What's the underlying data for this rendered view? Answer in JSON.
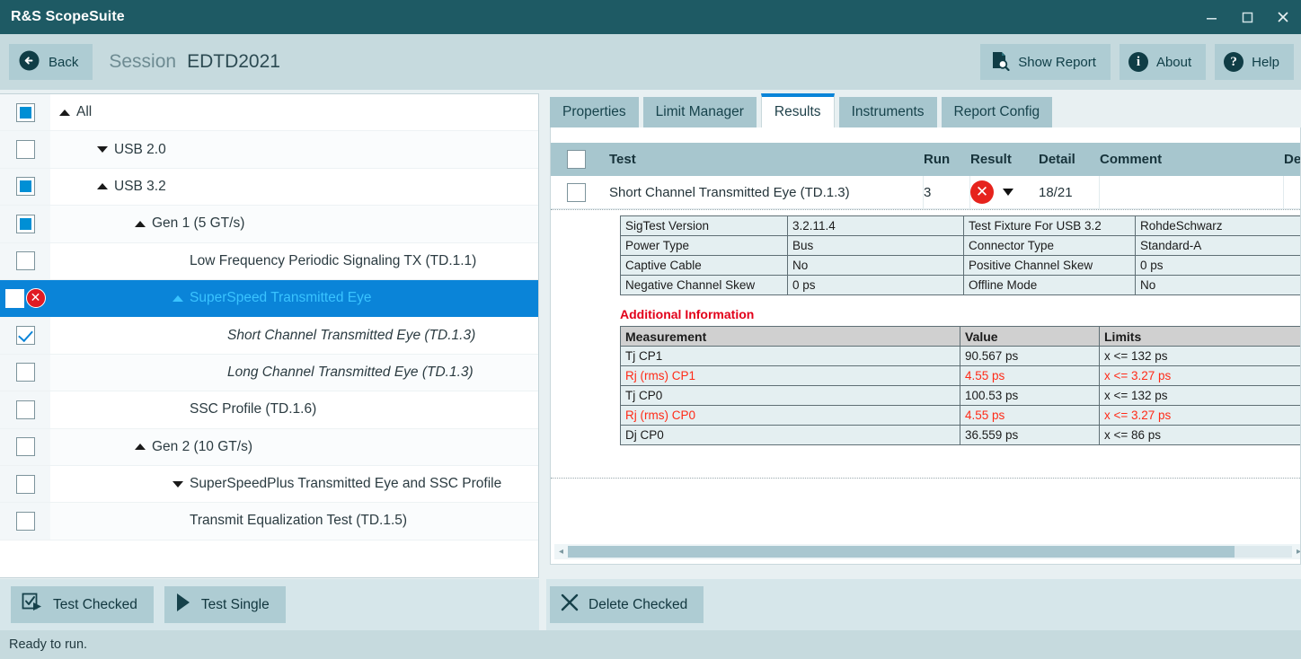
{
  "window": {
    "app_title": "R&S ScopeSuite",
    "minimize_icon": "minimize-icon",
    "maximize_icon": "maximize-icon",
    "close_icon": "close-icon"
  },
  "toolbar": {
    "back_label": "Back",
    "back_icon": "back-arrow-icon",
    "session_label": "Session",
    "session_value": "EDTD2021",
    "show_report_label": "Show Report",
    "show_report_icon": "report-search-icon",
    "about_label": "About",
    "about_icon": "info-icon",
    "about_glyph": "i",
    "help_label": "Help",
    "help_icon": "question-icon",
    "help_glyph": "?"
  },
  "tree": {
    "items": [
      {
        "label": "All",
        "indent": 0,
        "state": "filled",
        "expander": "up",
        "selected": false,
        "italic": false,
        "error": false
      },
      {
        "label": "USB 2.0",
        "indent": 1,
        "state": "empty",
        "expander": "down",
        "selected": false,
        "italic": false,
        "error": false
      },
      {
        "label": "USB 3.2",
        "indent": 1,
        "state": "filled",
        "expander": "up",
        "selected": false,
        "italic": false,
        "error": false
      },
      {
        "label": "Gen 1 (5 GT/s)",
        "indent": 2,
        "state": "filled",
        "expander": "up",
        "selected": false,
        "italic": false,
        "error": false
      },
      {
        "label": "Low Frequency Periodic Signaling TX (TD.1.1)",
        "indent": 3,
        "state": "empty",
        "expander": "none",
        "selected": false,
        "italic": false,
        "error": false
      },
      {
        "label": "SuperSpeed Transmitted Eye",
        "indent": 3,
        "state": "empty",
        "expander": "up",
        "selected": true,
        "italic": false,
        "error": true
      },
      {
        "label": "Short Channel Transmitted Eye (TD.1.3)",
        "indent": 4,
        "state": "checked",
        "expander": "none",
        "selected": false,
        "italic": true,
        "error": false
      },
      {
        "label": "Long Channel Transmitted Eye (TD.1.3)",
        "indent": 4,
        "state": "empty",
        "expander": "none",
        "selected": false,
        "italic": true,
        "error": false
      },
      {
        "label": "SSC Profile (TD.1.6)",
        "indent": 3,
        "state": "empty",
        "expander": "none",
        "selected": false,
        "italic": false,
        "error": false
      },
      {
        "label": "Gen 2 (10 GT/s)",
        "indent": 2,
        "state": "empty",
        "expander": "up",
        "selected": false,
        "italic": false,
        "error": false
      },
      {
        "label": "SuperSpeedPlus Transmitted Eye and SSC Profile",
        "indent": 3,
        "state": "empty",
        "expander": "down",
        "selected": false,
        "italic": false,
        "error": false
      },
      {
        "label": "Transmit Equalization Test (TD.1.5)",
        "indent": 3,
        "state": "empty",
        "expander": "none",
        "selected": false,
        "italic": false,
        "error": false
      }
    ]
  },
  "left_footer": {
    "test_checked_label": "Test Checked",
    "test_checked_icon": "checked-run-icon",
    "test_single_label": "Test Single",
    "test_single_icon": "play-icon"
  },
  "right_footer": {
    "delete_checked_label": "Delete Checked",
    "delete_checked_icon": "cross-icon"
  },
  "tabs": [
    {
      "label": "Properties",
      "active": false
    },
    {
      "label": "Limit Manager",
      "active": false
    },
    {
      "label": "Results",
      "active": true
    },
    {
      "label": "Instruments",
      "active": false
    },
    {
      "label": "Report Config",
      "active": false
    }
  ],
  "results": {
    "columns": {
      "test": "Test",
      "run": "Run",
      "result": "Result",
      "detail": "Detail",
      "comment": "Comment",
      "description": "Descr"
    },
    "row": {
      "test": "Short Channel Transmitted Eye (TD.1.3)",
      "run": "3",
      "result_icon": "error-icon",
      "result_glyph": "✕",
      "detail": "18/21",
      "comment": "",
      "description": ""
    }
  },
  "detail_report": {
    "info_rows": [
      {
        "k1": "SigTest Version",
        "v1": "3.2.11.4",
        "k2": "Test Fixture For USB 3.2",
        "v2": "RohdeSchwarz"
      },
      {
        "k1": "Power Type",
        "v1": "Bus",
        "k2": "Connector Type",
        "v2": "Standard-A"
      },
      {
        "k1": "Captive Cable",
        "v1": "No",
        "k2": "Positive Channel Skew",
        "v2": "0 ps"
      },
      {
        "k1": "Negative Channel Skew",
        "v1": "0 ps",
        "k2": "Offline Mode",
        "v2": "No"
      }
    ],
    "additional_information_title": "Additional Information",
    "meas_headers": {
      "measurement": "Measurement",
      "value": "Value",
      "limits": "Limits"
    },
    "meas_rows": [
      {
        "measurement": "Tj CP1",
        "value": "90.567 ps",
        "limits": "x <= 132 ps",
        "fail": false
      },
      {
        "measurement": "Rj (rms) CP1",
        "value": "4.55 ps",
        "limits": "x <= 3.27 ps",
        "fail": true
      },
      {
        "measurement": "Tj CP0",
        "value": "100.53 ps",
        "limits": "x <= 132 ps",
        "fail": false
      },
      {
        "measurement": "Rj (rms) CP0",
        "value": "4.55 ps",
        "limits": "x <= 3.27 ps",
        "fail": true
      },
      {
        "measurement": "Dj CP0",
        "value": "36.559 ps",
        "limits": "x <= 86 ps",
        "fail": false
      }
    ]
  },
  "scrollbar": {
    "left_arrow": "◂",
    "right_arrow": "▸"
  },
  "statusbar": {
    "text": "Ready to run."
  },
  "colors": {
    "title_bar": "#1e5a64",
    "toolbar": "#c6dade",
    "accent_blue": "#0a84d8",
    "selected_text": "#39c3ff",
    "error_red": "#e6231d",
    "fail_red": "#ff2a17",
    "additional_info_red": "#e2001a"
  }
}
